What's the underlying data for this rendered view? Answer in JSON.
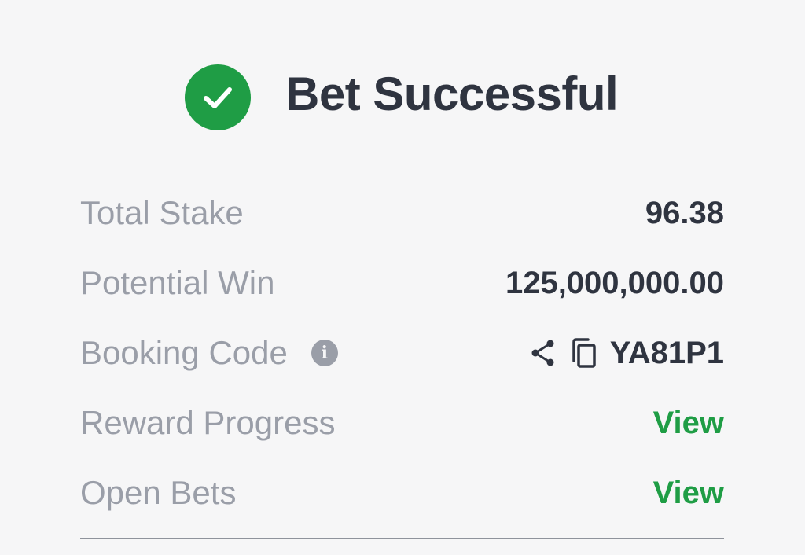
{
  "header": {
    "title": "Bet Successful",
    "icon": "check-circle-icon",
    "success_color": "#1f9d45"
  },
  "details": {
    "total_stake": {
      "label": "Total Stake",
      "value": "96.38"
    },
    "potential_win": {
      "label": "Potential Win",
      "value": "125,000,000.00"
    },
    "booking_code": {
      "label": "Booking Code",
      "info_icon": "info-icon",
      "share_icon": "share-icon",
      "copy_icon": "copy-icon",
      "value": "YA81P1"
    },
    "reward_progress": {
      "label": "Reward Progress",
      "action": "View"
    },
    "open_bets": {
      "label": "Open Bets",
      "action": "View"
    }
  },
  "colors": {
    "label": "#9a9ea8",
    "value": "#2f3440",
    "link": "#1f9d45",
    "background": "#f6f6f7"
  }
}
